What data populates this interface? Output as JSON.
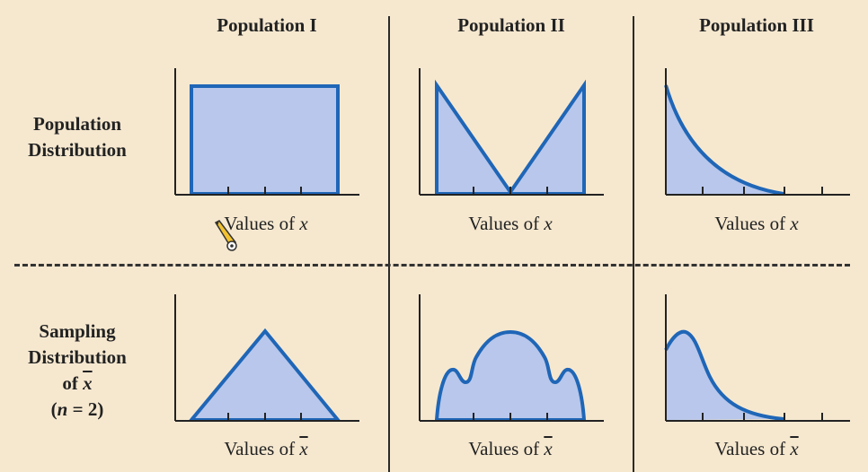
{
  "columns": [
    "Population I",
    "Population II",
    "Population III"
  ],
  "rows": {
    "population": [
      "Population",
      "Distribution"
    ],
    "sampling": [
      "Sampling",
      "Distribution",
      "of",
      "x",
      "(",
      "n",
      " = 2)"
    ]
  },
  "x_label_prefix": "Values of ",
  "x_var": "x",
  "x_bar_var": "x",
  "colors": {
    "fill": "#b8c7eb",
    "stroke": "#1f66b7",
    "axis": "#222222",
    "background": "#f6e8cf"
  }
}
